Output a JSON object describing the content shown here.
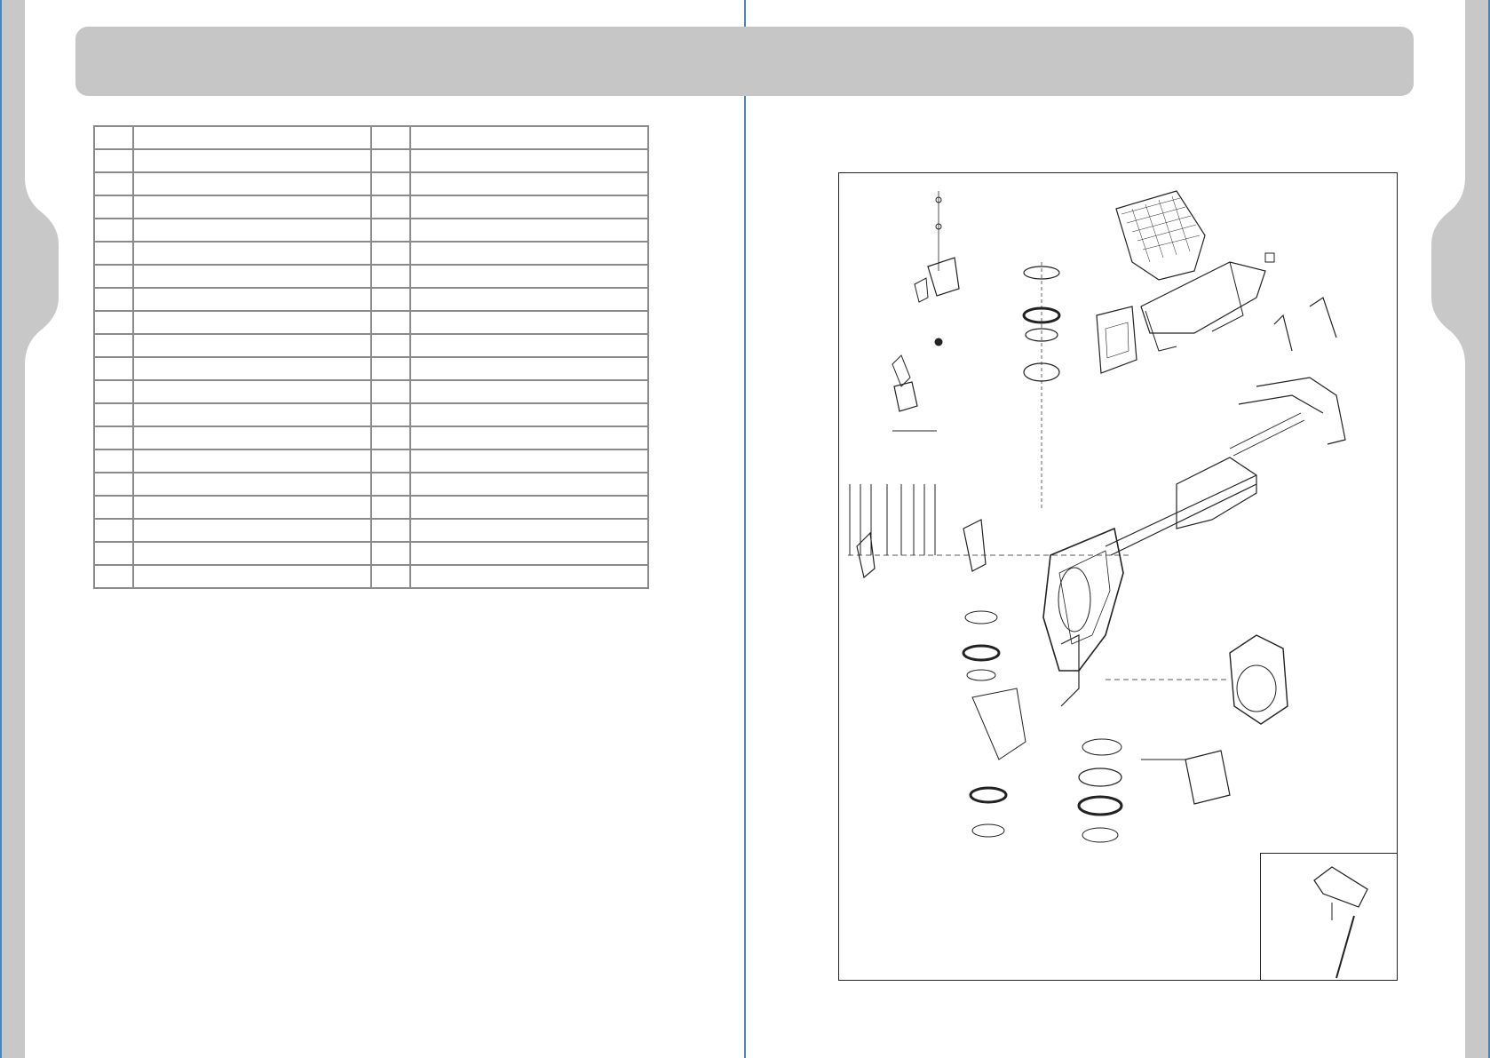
{
  "header": {
    "title": ""
  },
  "parts_table": {
    "rows": [
      {
        "left_no": "",
        "left_desc": "",
        "right_no": "",
        "right_desc": ""
      },
      {
        "left_no": "",
        "left_desc": "",
        "right_no": "",
        "right_desc": ""
      },
      {
        "left_no": "",
        "left_desc": "",
        "right_no": "",
        "right_desc": ""
      },
      {
        "left_no": "",
        "left_desc": "",
        "right_no": "",
        "right_desc": ""
      },
      {
        "left_no": "",
        "left_desc": "",
        "right_no": "",
        "right_desc": ""
      },
      {
        "left_no": "",
        "left_desc": "",
        "right_no": "",
        "right_desc": ""
      },
      {
        "left_no": "",
        "left_desc": "",
        "right_no": "",
        "right_desc": ""
      },
      {
        "left_no": "",
        "left_desc": "",
        "right_no": "",
        "right_desc": ""
      },
      {
        "left_no": "",
        "left_desc": "",
        "right_no": "",
        "right_desc": ""
      },
      {
        "left_no": "",
        "left_desc": "",
        "right_no": "",
        "right_desc": ""
      },
      {
        "left_no": "",
        "left_desc": "",
        "right_no": "",
        "right_desc": ""
      },
      {
        "left_no": "",
        "left_desc": "",
        "right_no": "",
        "right_desc": ""
      },
      {
        "left_no": "",
        "left_desc": "",
        "right_no": "",
        "right_desc": ""
      },
      {
        "left_no": "",
        "left_desc": "",
        "right_no": "",
        "right_desc": ""
      },
      {
        "left_no": "",
        "left_desc": "",
        "right_no": "",
        "right_desc": ""
      },
      {
        "left_no": "",
        "left_desc": "",
        "right_no": "",
        "right_desc": ""
      },
      {
        "left_no": "",
        "left_desc": "",
        "right_no": "",
        "right_desc": ""
      },
      {
        "left_no": "",
        "left_desc": "",
        "right_no": "",
        "right_desc": ""
      },
      {
        "left_no": "",
        "left_desc": "",
        "right_no": "",
        "right_desc": ""
      },
      {
        "left_no": "",
        "left_desc": "",
        "right_no": "",
        "right_desc": ""
      }
    ]
  },
  "diagram": {
    "subject": "exploded-view-lawn-mower",
    "colors": {
      "line": "#222222",
      "page_tab": "#c8c8c8",
      "spine": "#4a87b8"
    }
  }
}
